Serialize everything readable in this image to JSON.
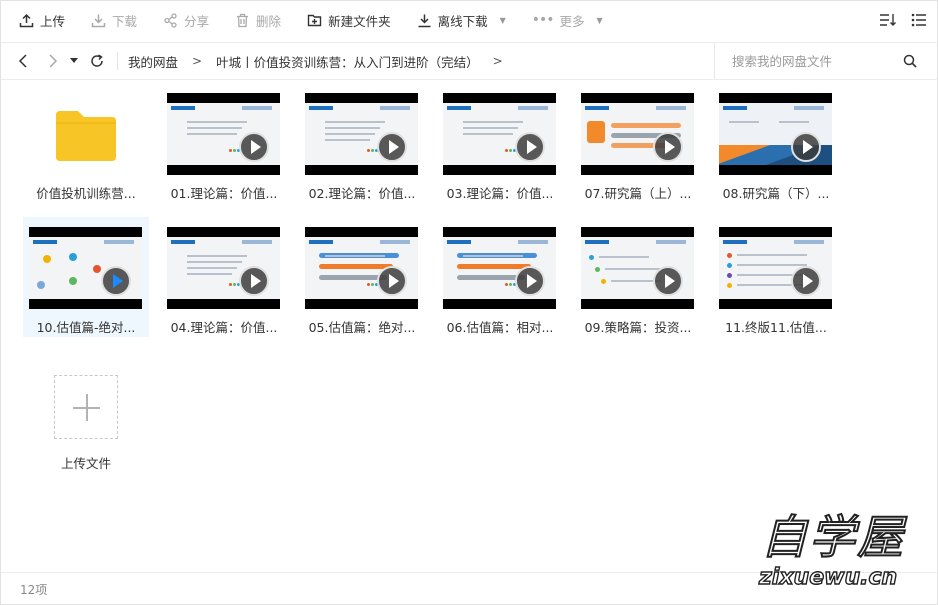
{
  "toolbar": {
    "upload": "上传",
    "download": "下载",
    "share": "分享",
    "delete": "删除",
    "new_folder": "新建文件夹",
    "offline_download": "离线下载",
    "more": "更多"
  },
  "nav": {
    "breadcrumb_root": "我的网盘",
    "breadcrumb_folder": "叶城丨价值投资训练营：从入门到进阶（完结）",
    "search_placeholder": "搜索我的网盘文件"
  },
  "files": [
    {
      "name": "价值投机训练营...",
      "type": "folder",
      "icon": "folder-icon"
    },
    {
      "name": "01.理论篇：价值...",
      "type": "video"
    },
    {
      "name": "02.理论篇：价值...",
      "type": "video"
    },
    {
      "name": "03.理论篇：价值...",
      "type": "video"
    },
    {
      "name": "07.研究篇（上）...",
      "type": "video"
    },
    {
      "name": "08.研究篇（下）...",
      "type": "video"
    },
    {
      "name": "10.估值篇-绝对...",
      "type": "video",
      "selected": true
    },
    {
      "name": "04.理论篇：价值...",
      "type": "video"
    },
    {
      "name": "05.估值篇：绝对...",
      "type": "video"
    },
    {
      "name": "06.估值篇：相对...",
      "type": "video"
    },
    {
      "name": "09.策略篇：投资...",
      "type": "video"
    },
    {
      "name": "11.终版11.估值...",
      "type": "video"
    }
  ],
  "upload_tile": {
    "label": "上传文件"
  },
  "footer": {
    "count": "12项"
  },
  "watermark": {
    "main": "自学屋",
    "sub": "zixuewu.cn"
  },
  "colors": {
    "accent": "#1a8cff",
    "folder": "#f7c626",
    "selected_bg": "#eef6fe"
  }
}
